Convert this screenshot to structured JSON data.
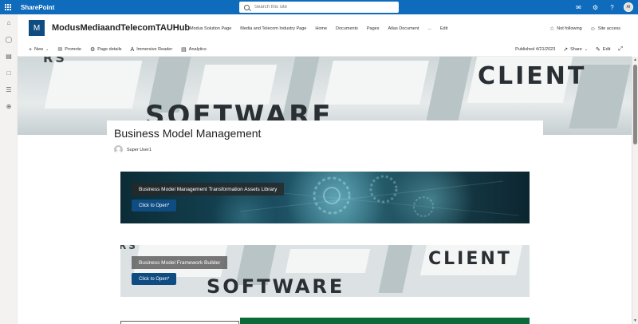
{
  "suite_bar": {
    "app_name": "SharePoint",
    "search_placeholder": "Search this site",
    "avatar_initials": "AI",
    "bg_color": "#0f6cbd"
  },
  "app_bar": {
    "icons": [
      "home-icon",
      "globe-icon",
      "news-icon",
      "file-icon",
      "list-icon",
      "add-icon"
    ]
  },
  "site": {
    "logo_letter": "M",
    "title": "ModusMediaandTelecomTAUHub",
    "nav": [
      "Modus Solution Page",
      "Media and Telecom Industry Page",
      "Home",
      "Documents",
      "Pages",
      "Atlas Document",
      "...",
      "Edit"
    ],
    "follow_label": "Not following",
    "site_access_label": "Site access"
  },
  "command_bar": {
    "new_label": "New",
    "promote_label": "Promote",
    "page_details_label": "Page details",
    "immersive_reader_label": "Immersive Reader",
    "analytics_label": "Analytics",
    "published_label": "Published 4/21/2023",
    "share_label": "Share",
    "edit_label": "Edit"
  },
  "hero": {
    "word_software": "SOFTWARE",
    "word_client": "CLIENT"
  },
  "page": {
    "title": "Business Model Management",
    "author": "Super User1"
  },
  "banners": [
    {
      "label": "Business Model Management Transformation Assets Library",
      "button": "Click to Open*"
    },
    {
      "label": "Business Model Framework Builder",
      "button": "Click to Open*",
      "word_software": "SOFTWARE",
      "word_client": "CLIENT"
    }
  ],
  "colors": {
    "accent": "#0f4c81",
    "bottom_bar": "#0b6a3a"
  }
}
